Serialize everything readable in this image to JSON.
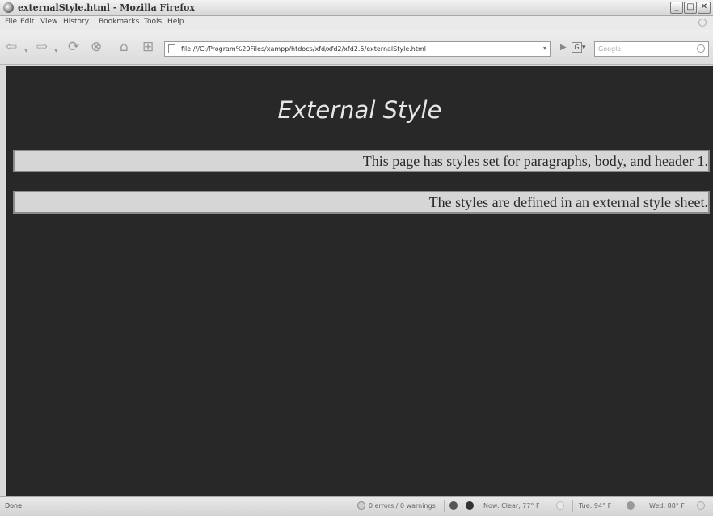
{
  "window": {
    "title": "externalStyle.html - Mozilla Firefox",
    "buttons": {
      "minimize": "_",
      "maximize": "□",
      "close": "✕"
    }
  },
  "menubar": {
    "items": [
      "File",
      "Edit",
      "View",
      "History",
      "Bookmarks",
      "Tools",
      "Help"
    ]
  },
  "navbar": {
    "url": "file:///C:/Program%20Files/xampp/htdocs/xfd/xfd2/xfd2.5/externalStyle.html",
    "search_placeholder": "Google",
    "search_engine": "G"
  },
  "page": {
    "heading": "External Style",
    "paragraphs": [
      "This page has styles set for paragraphs, body, and header 1.",
      "The styles are defined in an external style sheet."
    ],
    "background_color": "#282828",
    "paragraph_background": "#d6d6d6"
  },
  "statusbar": {
    "status": "Done",
    "errors": "0 errors / 0 warnings",
    "weather_now": "Now: Clear, 77° F",
    "weather_tue": "Tue: 94° F",
    "weather_wed": "Wed: 88° F"
  },
  "icons": [
    "firefox-icon",
    "back-icon",
    "forward-icon",
    "reload-icon",
    "stop-icon",
    "home-icon",
    "new-tab-icon",
    "page-icon",
    "go-icon",
    "search-icon",
    "validator-icon",
    "weather-icon"
  ]
}
